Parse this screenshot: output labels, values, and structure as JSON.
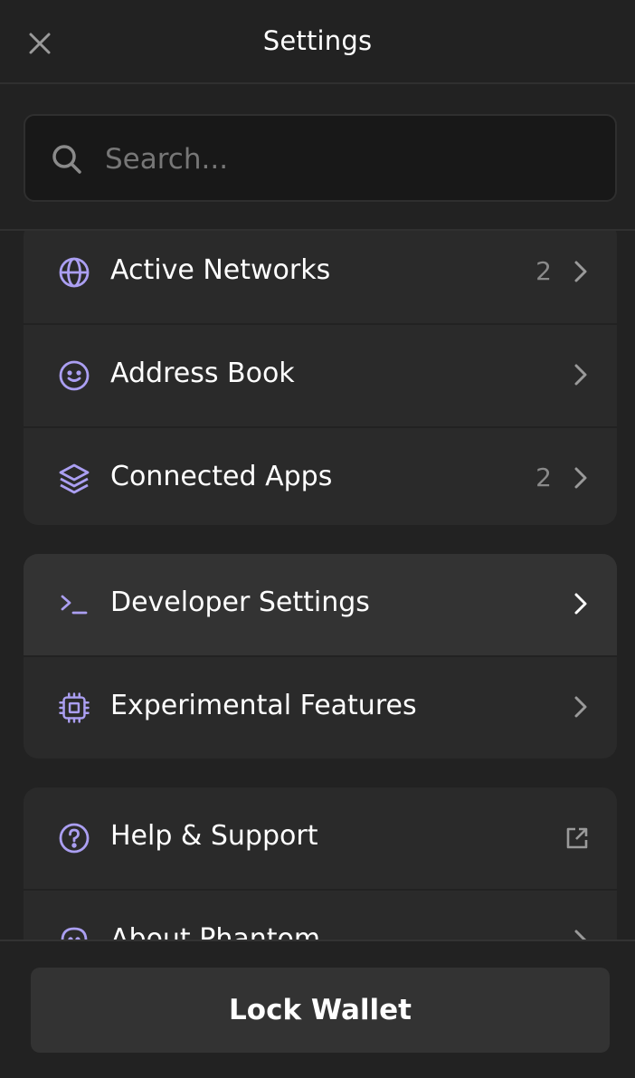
{
  "header": {
    "title": "Settings",
    "close_icon": "close-icon"
  },
  "search": {
    "placeholder": "Search...",
    "value": "",
    "icon": "search-icon"
  },
  "accent_color": "#ab9ff2",
  "groups": [
    {
      "items": [
        {
          "label": "Active Networks",
          "count": "2",
          "icon": "globe-icon"
        },
        {
          "label": "Address Book",
          "count": "",
          "icon": "smiley-icon"
        },
        {
          "label": "Connected Apps",
          "count": "2",
          "icon": "layers-icon"
        }
      ]
    },
    {
      "items": [
        {
          "label": "Developer Settings",
          "count": "",
          "icon": "terminal-icon"
        },
        {
          "label": "Experimental Features",
          "count": "",
          "icon": "chip-icon"
        }
      ]
    },
    {
      "items": [
        {
          "label": "Help & Support",
          "count": "",
          "icon": "help-icon"
        },
        {
          "label": "About Phantom",
          "count": "",
          "icon": "ghost-icon"
        }
      ]
    }
  ],
  "footer": {
    "lock_label": "Lock Wallet"
  }
}
